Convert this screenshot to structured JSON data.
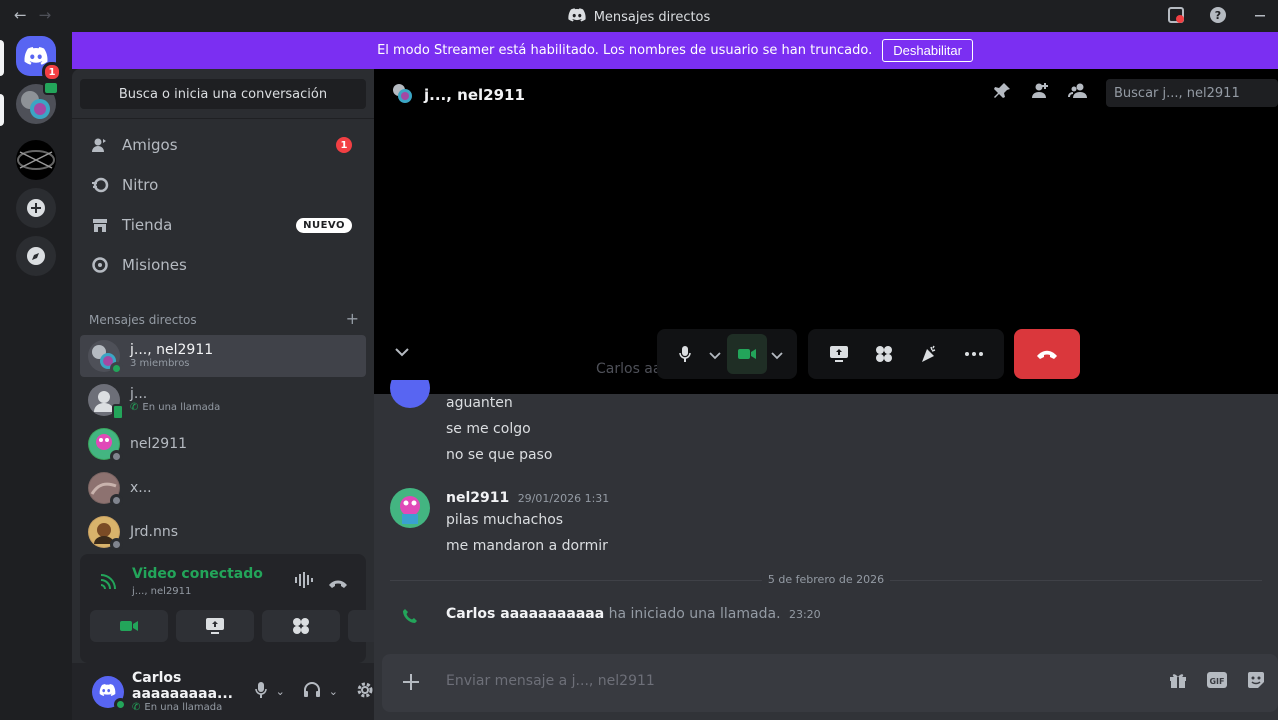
{
  "window": {
    "title": "Mensajes directos",
    "back": "←",
    "forward": "→"
  },
  "servers": {
    "home_badge": "1"
  },
  "banner": {
    "text": "El modo Streamer está habilitado. Los nombres de usuario se han truncado.",
    "button": "Deshabilitar"
  },
  "sidebar": {
    "search": "Busca o inicia una conversación",
    "nav": [
      {
        "label": "Amigos",
        "badge": "1"
      },
      {
        "label": "Nitro"
      },
      {
        "label": "Tienda",
        "tag": "NUEVO"
      },
      {
        "label": "Misiones"
      }
    ],
    "dm_header": "Mensajes directos",
    "dm_add": "+",
    "dms": [
      {
        "name": "j..., nel2911",
        "sub": "3 miembros"
      },
      {
        "name": "j...",
        "sub": "En una llamada"
      },
      {
        "name": "nel2911"
      },
      {
        "name": "x..."
      },
      {
        "name": "Jrd.nns"
      }
    ]
  },
  "voice": {
    "title": "Video conectado",
    "channel": "j..., nel2911"
  },
  "user": {
    "name": "Carlos aaaaaaaaa...",
    "status": "En una llamada"
  },
  "chat": {
    "title": "j..., nel2911",
    "search_placeholder": "Buscar j..., nel2911",
    "caller_hint": "Carlos aa",
    "messages_top": [
      "aguanten",
      "se me colgo",
      "no se que paso"
    ],
    "msg2_author": "nel2911",
    "msg2_time": "29/01/2026 1:31",
    "msg2_lines": [
      "pilas muchachos",
      "me mandaron a dormir"
    ],
    "date_divider": "5 de febrero de 2026",
    "call_author": "Carlos  aaaaaaaaaaa",
    "call_text": "ha iniciado una llamada.",
    "call_time": "23:20",
    "composer_placeholder": "Enviar mensaje a j..., nel2911"
  },
  "colors": {
    "accent": "#5865f2",
    "banner": "#7b2ff2",
    "online": "#23a55a",
    "danger": "#da373c"
  }
}
